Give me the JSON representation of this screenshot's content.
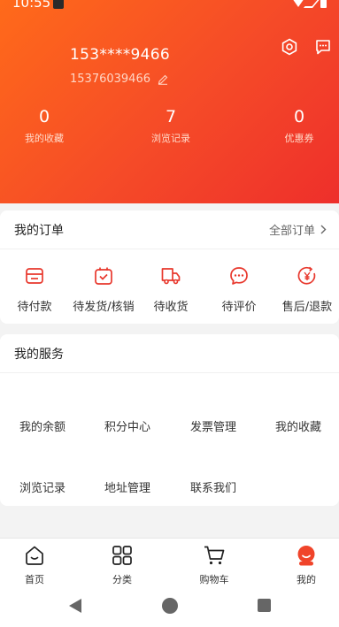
{
  "status_bar": {
    "time": "10:55"
  },
  "colors": {
    "accent": "#f04e2a",
    "header_start": "#ff6a1a",
    "header_end": "#ee2f2b"
  },
  "user": {
    "display_name": "153****9466",
    "phone": "15376039466"
  },
  "stats": [
    {
      "value": "0",
      "label": "我的收藏"
    },
    {
      "value": "7",
      "label": "浏览记录"
    },
    {
      "value": "0",
      "label": "优惠券"
    }
  ],
  "orders": {
    "title": "我的订单",
    "all_label": "全部订单",
    "items": [
      {
        "label": "待付款",
        "icon": "wallet-icon"
      },
      {
        "label": "待发货/核销",
        "icon": "package-check-icon"
      },
      {
        "label": "待收货",
        "icon": "truck-icon"
      },
      {
        "label": "待评价",
        "icon": "chat-bubble-icon"
      },
      {
        "label": "售后/退款",
        "icon": "refund-icon"
      }
    ]
  },
  "services": {
    "title": "我的服务",
    "items": [
      "我的余额",
      "积分中心",
      "发票管理",
      "我的收藏",
      "浏览记录",
      "地址管理",
      "联系我们"
    ]
  },
  "tabbar": [
    {
      "label": "首页",
      "icon": "home-icon"
    },
    {
      "label": "分类",
      "icon": "grid-icon"
    },
    {
      "label": "购物车",
      "icon": "cart-icon"
    },
    {
      "label": "我的",
      "icon": "profile-icon",
      "active": true
    }
  ]
}
